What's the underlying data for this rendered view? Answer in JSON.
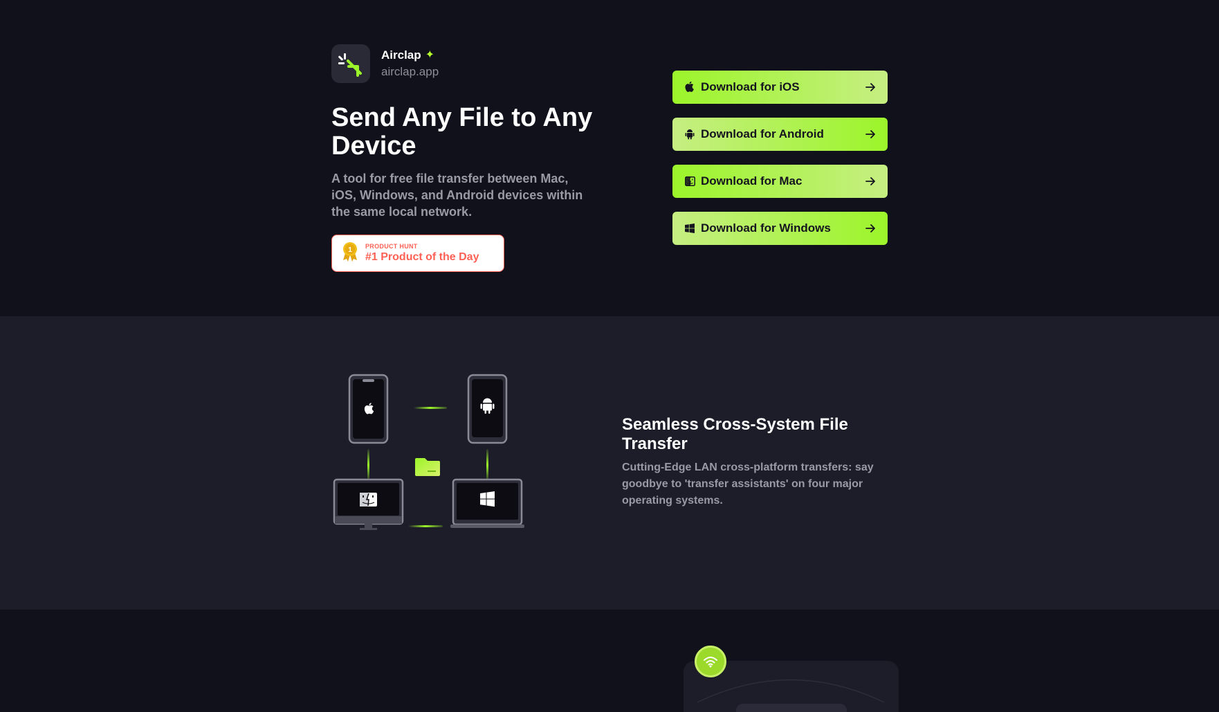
{
  "brand": {
    "name": "Airclap",
    "sparkle": "✦",
    "domain": "airclap.app"
  },
  "hero": {
    "title": "Send Any File to Any Device",
    "subtitle": "A tool for free file transfer between Mac, iOS, Windows, and Android devices within the same local network.",
    "badge": {
      "small": "PRODUCT HUNT",
      "big": "#1 Product of the Day",
      "rank": "1"
    }
  },
  "downloads": [
    {
      "label": "Download for iOS",
      "icon": "apple-icon"
    },
    {
      "label": "Download for Android",
      "icon": "android-icon"
    },
    {
      "label": "Download for Mac",
      "icon": "finder-icon"
    },
    {
      "label": "Download for Windows",
      "icon": "windows-icon"
    }
  ],
  "feature": {
    "title": "Seamless Cross-System File Transfer",
    "description": "Cutting-Edge LAN cross-platform transfers: say goodbye to 'transfer assistants' on four major operating systems."
  },
  "colors": {
    "background": "#11111b",
    "section_alt": "#1d1d2a",
    "accent": "#9cf52a",
    "accent_light": "#c6ee82",
    "product_hunt": "#ff6154"
  }
}
